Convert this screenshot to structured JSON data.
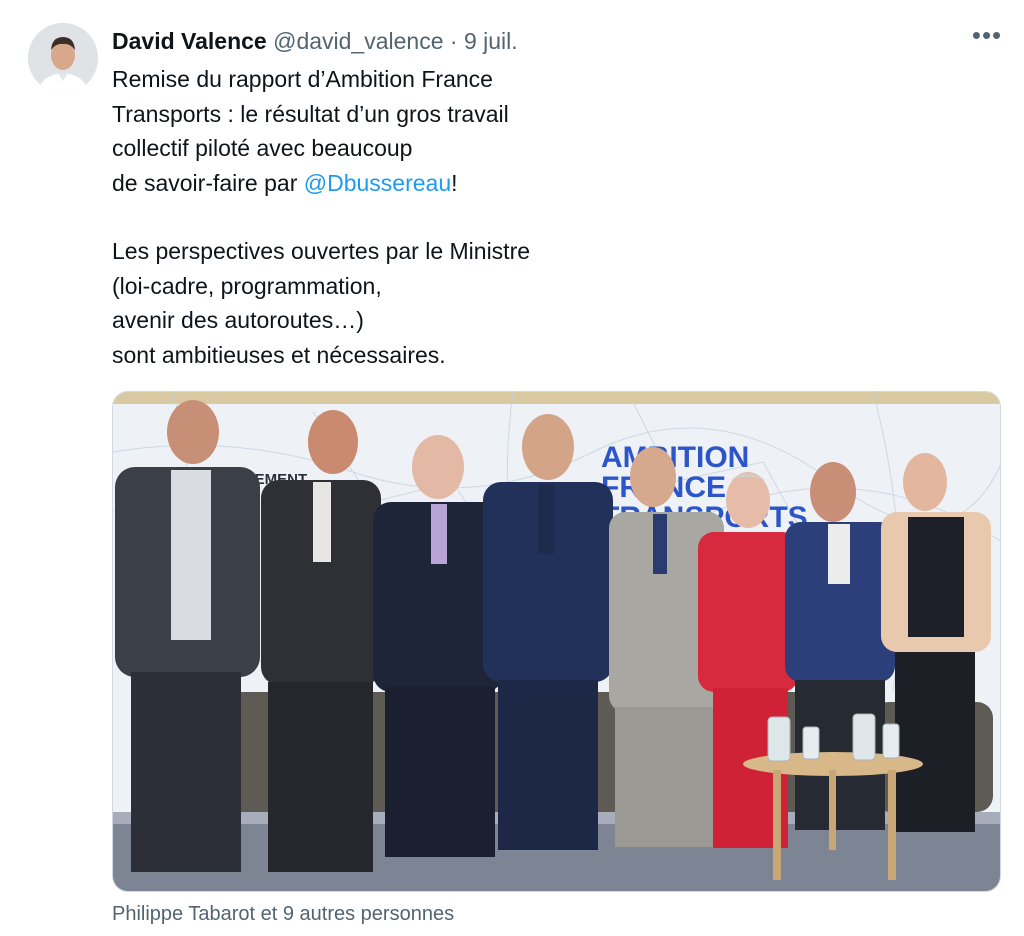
{
  "tweet": {
    "author_name": "David Valence",
    "author_handle": "@david_valence",
    "separator": "·",
    "date": "9 juil.",
    "more_label": "•••",
    "text_line1": "Remise du rapport d’Ambition France",
    "text_line2": "Transports : le résultat d’un gros travail",
    "text_line3": "collectif piloté avec beaucoup",
    "text_line4_prefix": "de savoir-faire par ",
    "mention": "@Dbussereau",
    "text_line4_suffix": "!",
    "text_line5": "Les perspectives ouvertes par le Ministre",
    "text_line6": "(loi-cadre, programmation,",
    "text_line7": "avenir des autoroutes…)",
    "text_line8": "sont ambitieuses et nécessaires."
  },
  "media": {
    "banner_line1": "AMBITION",
    "banner_line2": "FRANCE",
    "banner_line3": "TRANSPORTS",
    "government_text": "ERNEMENT",
    "caption": "Philippe Tabarot et 9 autres personnes"
  },
  "colors": {
    "mention": "#1d9bf0",
    "secondary_text": "#536471",
    "banner_blue": "#2b55c8"
  }
}
